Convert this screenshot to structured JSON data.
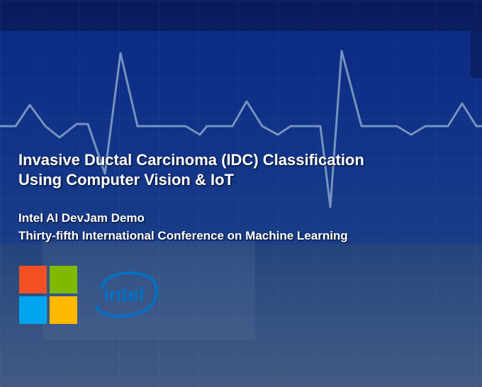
{
  "slide": {
    "title_line1": "Invasive Ductal Carcinoma (IDC) Classification",
    "title_line2": "Using Computer Vision & IoT",
    "subtitle_line1": "Intel AI DevJam Demo",
    "subtitle_line2": "Thirty-fifth International Conference on Machine Learning"
  },
  "logos": {
    "microsoft_logo": {
      "icon": "microsoft-logo-icon",
      "colors": [
        "#f25022",
        "#7fba00",
        "#00a4ef",
        "#ffb900"
      ]
    },
    "intel_logo": {
      "icon": "intel-logo-icon",
      "wordmark": "intel",
      "color": "#0071c5"
    }
  },
  "theme": {
    "background_top": "#0d1e66",
    "background_bottom": "#3c5680",
    "waveform_color": "#7f9ec4"
  }
}
